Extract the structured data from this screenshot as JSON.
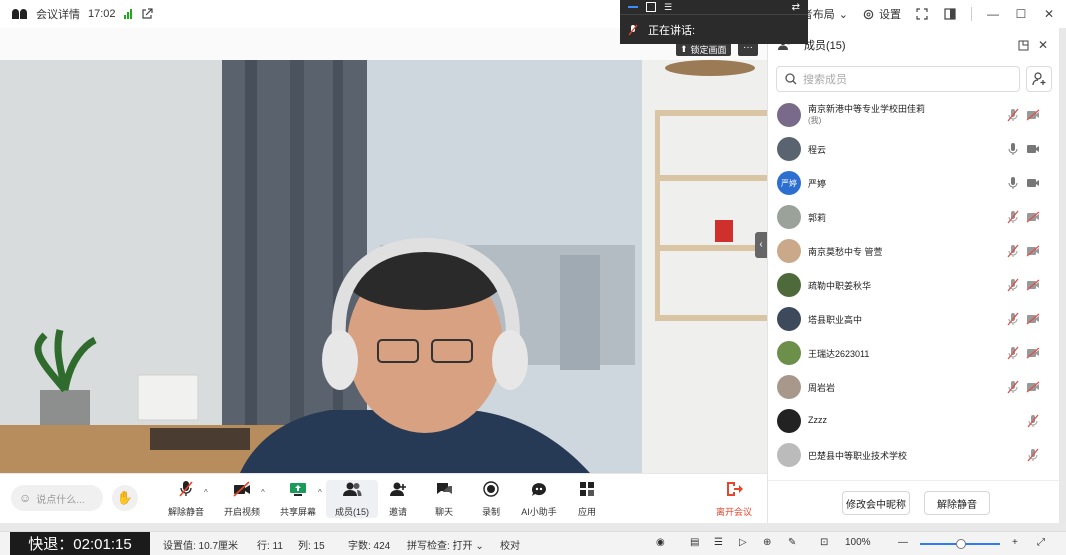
{
  "topbar": {
    "meeting_details": "会议详情",
    "time": "17:02",
    "layout_label": "演讲者布局",
    "settings_label": "设置"
  },
  "speaker_popup": {
    "speaking_label": "正在讲话:"
  },
  "video": {
    "lock_label": "锁定画面",
    "more": "···"
  },
  "toolbar": {
    "chat_placeholder": "说点什么...",
    "unmute": "解除静音",
    "start_video": "开启视频",
    "share_screen": "共享屏幕",
    "members": "成员(15)",
    "invite": "邀请",
    "chat": "聊天",
    "record": "录制",
    "ai_assistant": "AI小助手",
    "apps": "应用",
    "leave": "离开会议",
    "leave_color": "#e8462b"
  },
  "members_panel": {
    "title": "成员(15)",
    "search_placeholder": "搜索成员",
    "rename_button": "修改会中昵称",
    "unmute_all_button": "解除静音",
    "members": [
      {
        "name": "南京新港中等专业学校田佳莉",
        "sub": "(我)",
        "mic": "muted",
        "cam": "off",
        "avatar": "#7a6a8a"
      },
      {
        "name": "程云",
        "sub": "",
        "mic": "on",
        "cam": "on",
        "avatar": "#5a6470"
      },
      {
        "name": "严婷",
        "sub": "",
        "mic": "on",
        "cam": "on",
        "avatar": "#2d6fd0",
        "avatar_text": "严婷"
      },
      {
        "name": "郭莉",
        "sub": "",
        "mic": "muted",
        "cam": "off",
        "avatar": "#9aa29a"
      },
      {
        "name": "南京莫愁中专 管萱",
        "sub": "",
        "mic": "muted",
        "cam": "off",
        "avatar": "#c9a98a"
      },
      {
        "name": "疏勒中职姜秋华",
        "sub": "",
        "mic": "muted",
        "cam": "off",
        "avatar": "#4f6a3a"
      },
      {
        "name": "塔县职业高中",
        "sub": "",
        "mic": "muted",
        "cam": "off",
        "avatar": "#3d4a5c"
      },
      {
        "name": "王瑞达2623011",
        "sub": "",
        "mic": "muted",
        "cam": "off",
        "avatar": "#6c8f4a"
      },
      {
        "name": "周岩岩",
        "sub": "",
        "mic": "muted",
        "cam": "off",
        "avatar": "#a8988c"
      },
      {
        "name": "Zzzz",
        "sub": "",
        "mic": "muted",
        "cam": "none",
        "avatar": "#222222"
      },
      {
        "name": "巴楚县中等职业技术学校",
        "sub": "",
        "mic": "muted",
        "cam": "none",
        "avatar": "#bbbbbb"
      }
    ]
  },
  "statusbar": {
    "timer": "快退：02:01:15",
    "setting_value": "设置值: 10.7厘米",
    "row": "行: 11",
    "col": "列: 15",
    "word_count": "字数: 424",
    "spellcheck": "拼写检查: 打开",
    "proofread": "校对",
    "zoom": "100%"
  },
  "colors": {
    "accent": "#2d7cf6",
    "muted_icon": "#d9534f",
    "signal": "#1aad19"
  }
}
